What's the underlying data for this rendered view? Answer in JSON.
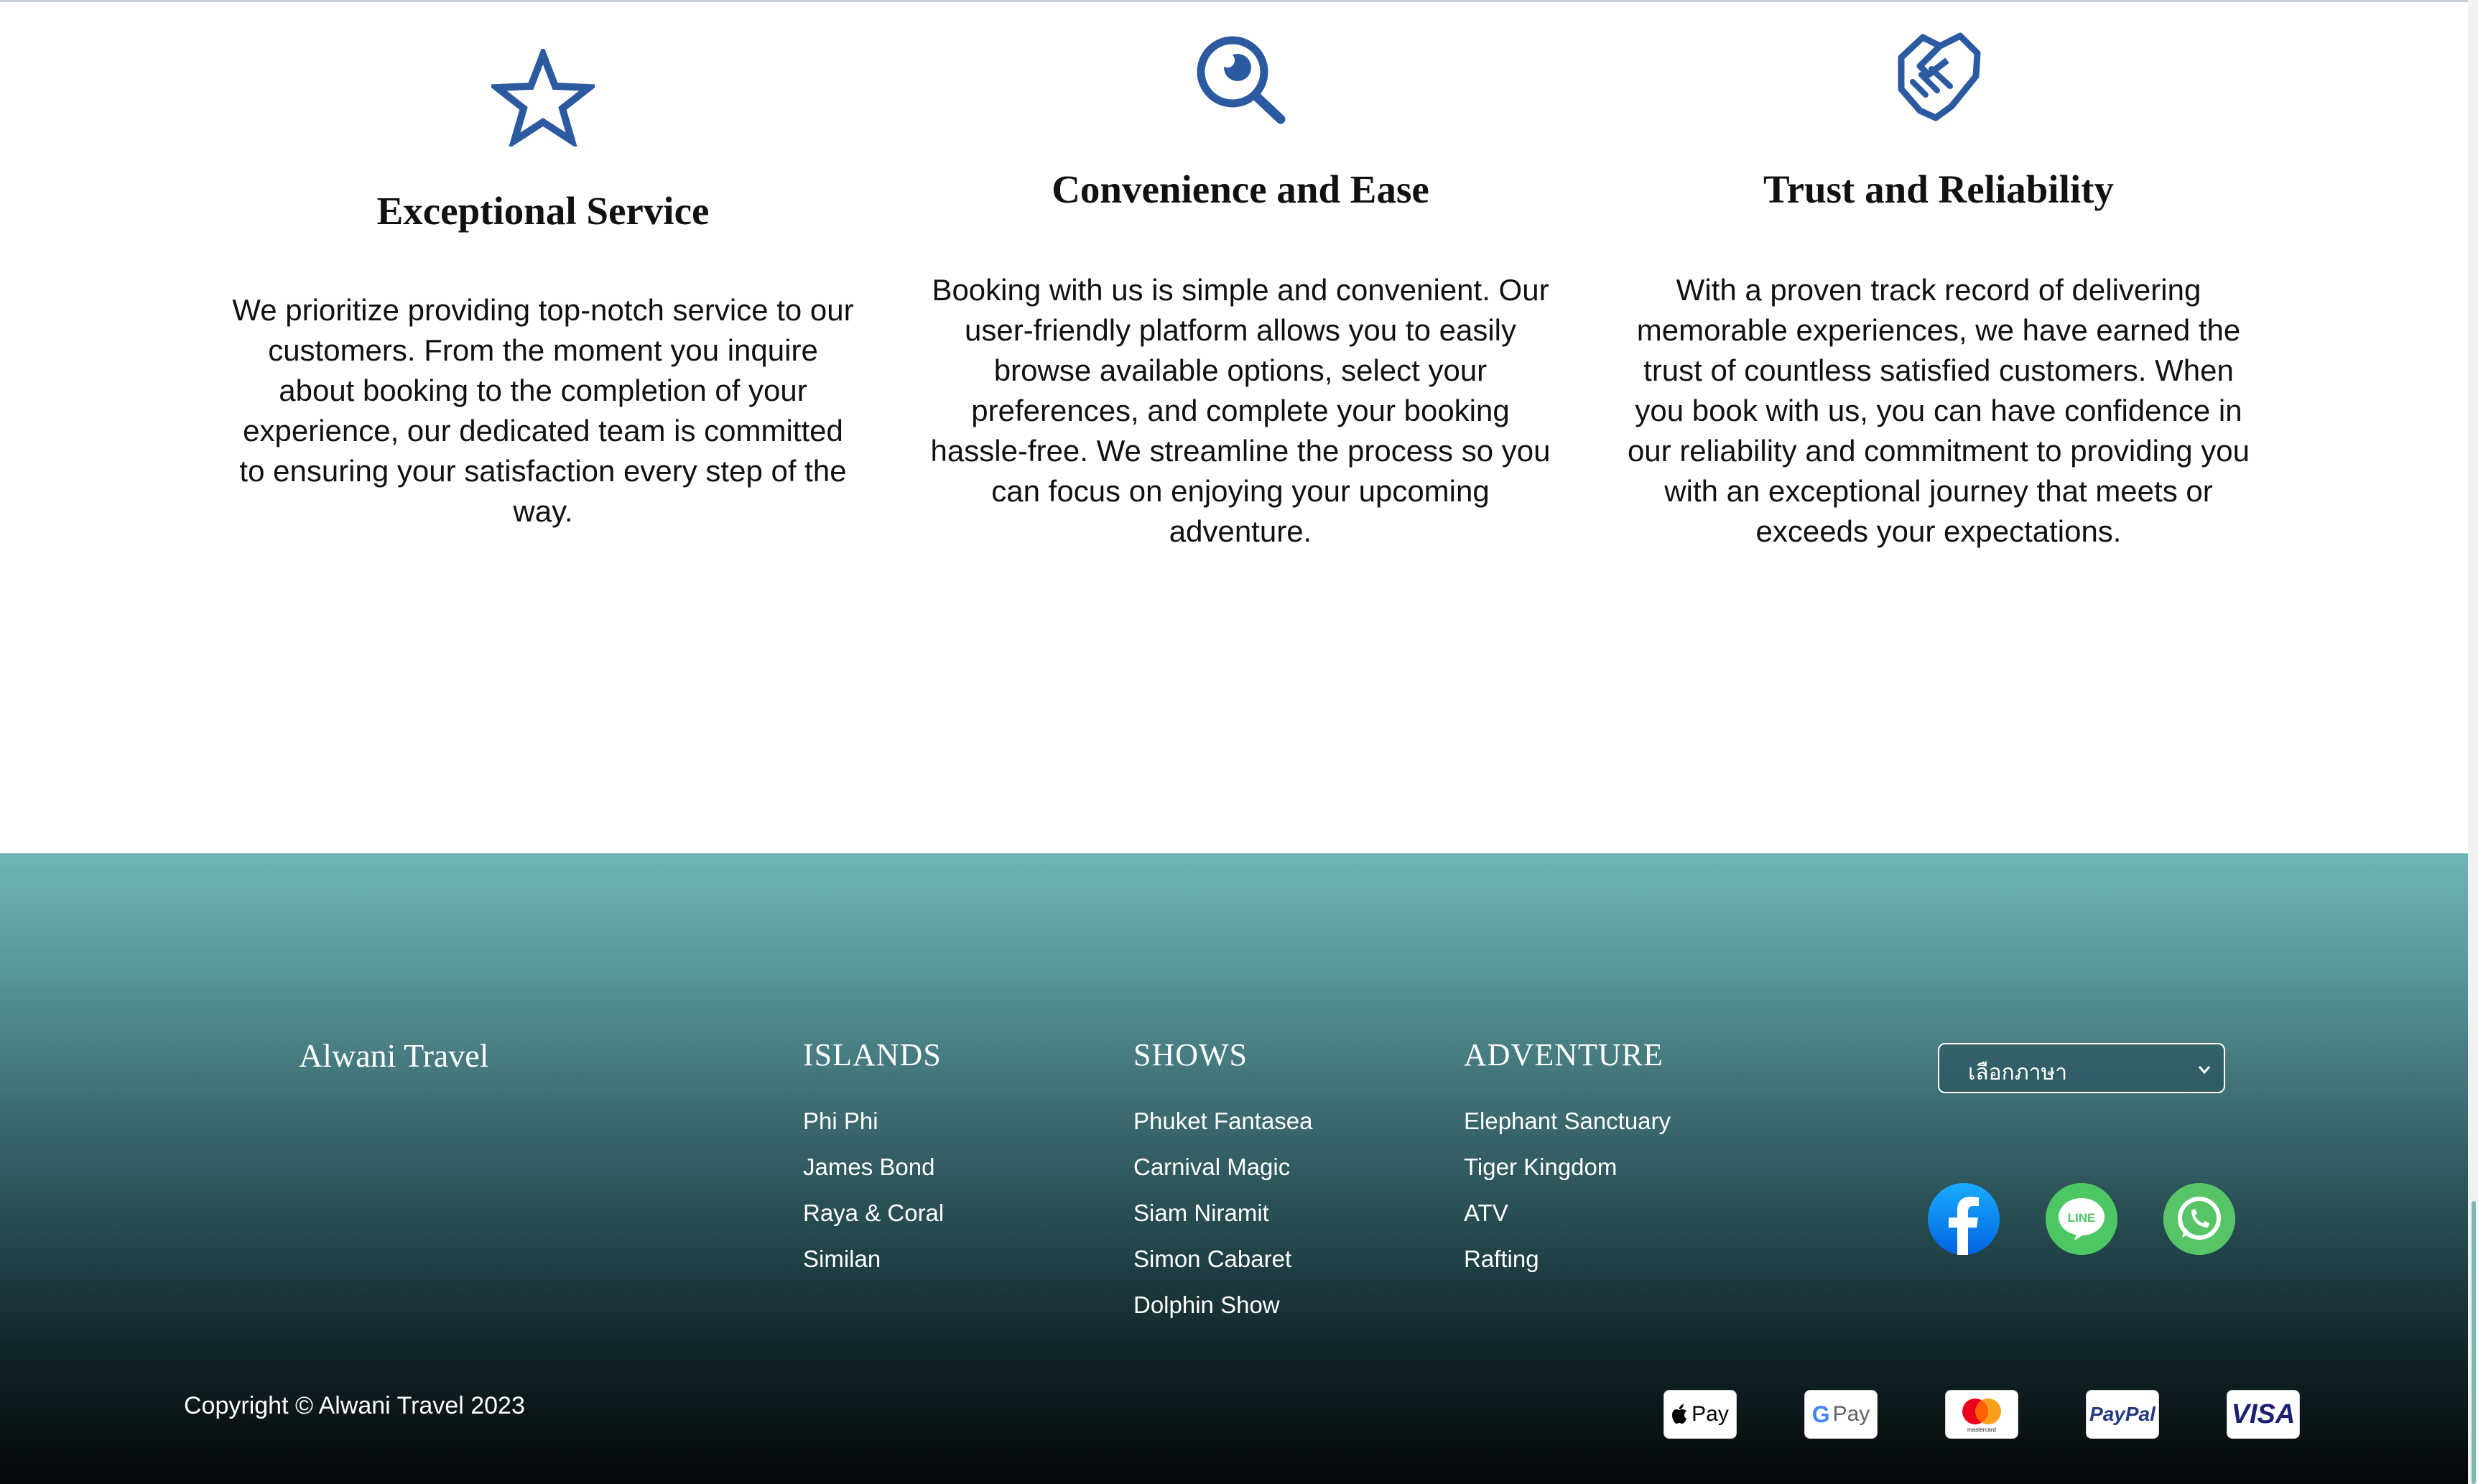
{
  "features": [
    {
      "icon": "star-icon",
      "title": "Exceptional Service",
      "body": "We prioritize providing top-notch service to our customers. From the moment you inquire about booking to the completion of your experience, our dedicated team is committed to ensuring your satisfaction every step of the way."
    },
    {
      "icon": "search-icon",
      "title": "Convenience and Ease",
      "body": "Booking with us is simple and convenient. Our user-friendly platform allows you to easily browse available options, select your preferences, and complete your booking hassle-free. We streamline the process so you can focus on enjoying your upcoming adventure."
    },
    {
      "icon": "handshake-icon",
      "title": "Trust and Reliability",
      "body": "With a proven track record of delivering memorable experiences, we have earned the trust of countless satisfied customers. When you book with us, you can have confidence in our reliability and commitment to providing you with an exceptional journey that meets or exceeds your expectations."
    }
  ],
  "footer": {
    "brand": "Alwani Travel",
    "columns": [
      {
        "heading": "ISLANDS",
        "items": [
          "Phi Phi",
          "James Bond",
          "Raya & Coral",
          "Similan"
        ]
      },
      {
        "heading": "SHOWS",
        "items": [
          "Phuket Fantasea",
          "Carnival Magic",
          "Siam Niramit",
          "Simon Cabaret",
          "Dolphin Show"
        ]
      },
      {
        "heading": "ADVENTURE",
        "items": [
          "Elephant Sanctuary",
          "Tiger Kingdom",
          "ATV",
          "Rafting"
        ]
      }
    ],
    "language_select": {
      "value": "เลือกภาษา"
    },
    "social": [
      "facebook-icon",
      "line-icon",
      "whatsapp-icon"
    ],
    "copyright": "Copyright © Alwani Travel 2023",
    "payments": [
      {
        "name": "apple-pay-icon",
        "label": "Pay"
      },
      {
        "name": "google-pay-icon",
        "label": "Pay"
      },
      {
        "name": "mastercard-icon",
        "label": "mastercard"
      },
      {
        "name": "paypal-icon",
        "label": "PayPal"
      },
      {
        "name": "visa-icon",
        "label": "VISA"
      }
    ]
  },
  "colors": {
    "icon_blue": "#2c5aa0",
    "footer_top": "#6db7b6",
    "footer_bottom": "#050709"
  }
}
